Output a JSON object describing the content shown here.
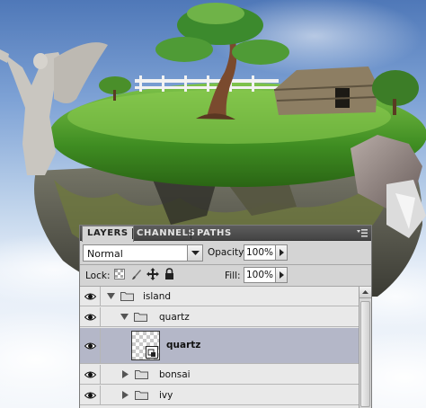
{
  "panel": {
    "tabs": [
      {
        "label": "LAYERS",
        "active": true
      },
      {
        "label": "CHANNELS",
        "active": false
      },
      {
        "label": "PATHS",
        "active": false
      }
    ],
    "blend_mode": "Normal",
    "opacity_label": "Opacity:",
    "opacity_value": "100%",
    "lock_label": "Lock:",
    "fill_label": "Fill:",
    "fill_value": "100%"
  },
  "layers": [
    {
      "name": "island",
      "type": "group",
      "expanded": true,
      "visible": true,
      "indent": 0,
      "selected": false
    },
    {
      "name": "quartz",
      "type": "group",
      "expanded": true,
      "visible": true,
      "indent": 1,
      "selected": false
    },
    {
      "name": "quartz",
      "type": "smart-object",
      "visible": true,
      "indent": 2,
      "selected": true
    },
    {
      "name": "bonsai",
      "type": "group",
      "expanded": false,
      "visible": true,
      "indent": 1,
      "selected": false
    },
    {
      "name": "ivy",
      "type": "group",
      "expanded": false,
      "visible": true,
      "indent": 1,
      "selected": false
    }
  ],
  "colors": {
    "panel_bg": "#d4d4d4",
    "tabbar_bg": "#4e4e4e",
    "layer_bg": "#e9e9e9",
    "selected_layer_bg": "#b4b7c8"
  },
  "icons": {
    "visibility": "eye-icon",
    "group": "folder-icon",
    "expand": "triangle-icon",
    "menu": "panel-menu-icon",
    "lock_transparent": "checkerboard-icon",
    "lock_image": "brush-icon",
    "lock_position": "move-icon",
    "lock_all": "padlock-icon"
  }
}
